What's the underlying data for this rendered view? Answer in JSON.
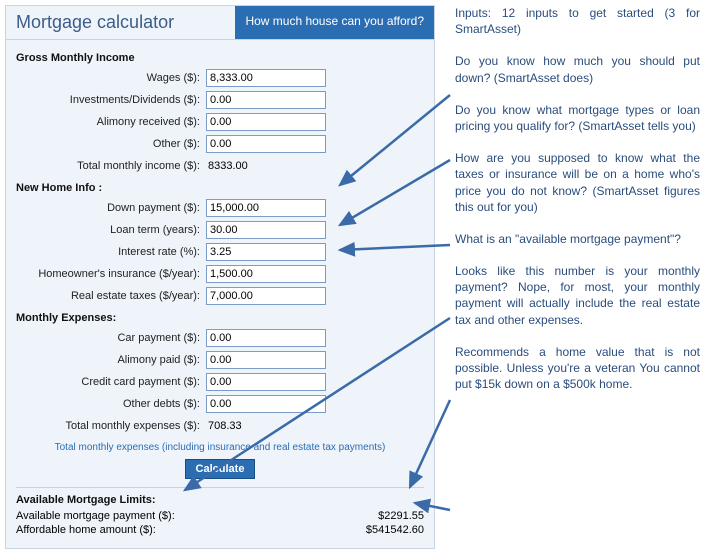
{
  "header": {
    "title": "Mortgage calculator",
    "tab": "How much house can you afford?"
  },
  "sections": {
    "income": {
      "title": "Gross Monthly Income",
      "wages_label": "Wages ($):",
      "wages": "8,333.00",
      "inv_label": "Investments/Dividends ($):",
      "inv": "0.00",
      "alimony_r_label": "Alimony received ($):",
      "alimony_r": "0.00",
      "other_label": "Other ($):",
      "other": "0.00",
      "total_label": "Total monthly income ($):",
      "total": "8333.00"
    },
    "home": {
      "title": "New Home Info :",
      "down_label": "Down payment ($):",
      "down": "15,000.00",
      "term_label": "Loan term (years):",
      "term": "30.00",
      "rate_label": "Interest rate (%):",
      "rate": "3.25",
      "ins_label": "Homeowner's insurance ($/year):",
      "ins": "1,500.00",
      "tax_label": "Real estate taxes ($/year):",
      "tax": "7,000.00"
    },
    "exp": {
      "title": "Monthly Expenses:",
      "car_label": "Car payment ($):",
      "car": "0.00",
      "alimony_p_label": "Alimony paid ($):",
      "alimony_p": "0.00",
      "cc_label": "Credit card payment ($):",
      "cc": "0.00",
      "debts_label": "Other debts ($):",
      "debts": "0.00",
      "total_label": "Total monthly expenses ($):",
      "total": "708.33"
    }
  },
  "note": "Total monthly expenses (including insurance and real estate tax payments)",
  "button": "Calculate",
  "limits": {
    "title": "Available Mortgage Limits:",
    "pay_label": "Available mortgage payment ($):",
    "pay": "$2291.55",
    "afford_label": "Affordable home amount ($):",
    "afford": "$541542.60"
  },
  "comments": {
    "c1": "Inputs: 12 inputs to get started (3 for SmartAsset)",
    "c2": "Do you know how much you should put down?  (SmartAsset does)",
    "c3": "Do you know what mortgage types or loan pricing you qualify for? (SmartAsset tells you)",
    "c4": "How are you supposed to know what the taxes or insurance will be on a home who's price you do not know? (SmartAsset figures this out for you)",
    "c5": "What is an \"available mortgage payment\"?",
    "c6": "Looks like this number is your monthly payment?  Nope, for most, your monthly payment will actually include the real estate tax and other expenses.",
    "c7": "Recommends a home value that is not possible. Unless you're a veteran You cannot put $15k down on a $500k home."
  }
}
